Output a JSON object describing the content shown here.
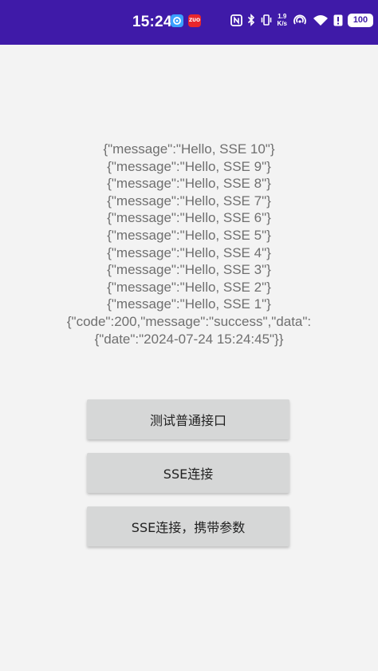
{
  "status_bar": {
    "time": "15:24",
    "net_speed_value": "1.9",
    "net_speed_unit": "K/s",
    "battery": "100",
    "badge_text": "ZUO"
  },
  "response": {
    "lines": [
      "{\"message\":\"Hello, SSE 10\"}",
      "{\"message\":\"Hello, SSE 9\"}",
      "{\"message\":\"Hello, SSE 8\"}",
      "{\"message\":\"Hello, SSE 7\"}",
      "{\"message\":\"Hello, SSE 6\"}",
      "{\"message\":\"Hello, SSE 5\"}",
      "{\"message\":\"Hello, SSE 4\"}",
      "{\"message\":\"Hello, SSE 3\"}",
      "{\"message\":\"Hello, SSE 2\"}",
      "{\"message\":\"Hello, SSE 1\"}",
      "{\"code\":200,\"message\":\"success\",\"data\":",
      "{\"date\":\"2024-07-24 15:24:45\"}}"
    ]
  },
  "buttons": {
    "normal_api": "测试普通接口",
    "sse_connect": "SSE连接",
    "sse_connect_params": "SSE连接，携带参数"
  },
  "colors": {
    "status_bar_bg": "#3f1aa8",
    "background": "#f3f3f3",
    "button_bg": "#d6d7d7",
    "response_text": "#6f6f6f"
  }
}
